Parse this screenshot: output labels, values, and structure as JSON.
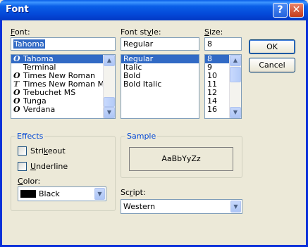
{
  "window": {
    "title": "Font",
    "help_glyph": "?",
    "close_glyph": "✕"
  },
  "font": {
    "label_key": "F",
    "label_rest": "ont:",
    "value": "Tahoma",
    "items": [
      {
        "label": "Tahoma",
        "icon": "O",
        "selected": true
      },
      {
        "label": "Terminal",
        "icon": "",
        "selected": false
      },
      {
        "label": "Times New Roman",
        "icon": "O",
        "selected": false
      },
      {
        "label": "Times New Roman MT",
        "icon": "T",
        "selected": false
      },
      {
        "label": "Trebuchet MS",
        "icon": "O",
        "selected": false
      },
      {
        "label": "Tunga",
        "icon": "O",
        "selected": false
      },
      {
        "label": "Verdana",
        "icon": "O",
        "selected": false
      }
    ]
  },
  "style": {
    "label_pre": "Font st",
    "label_key": "y",
    "label_post": "le:",
    "value": "Regular",
    "items": [
      {
        "label": "Regular",
        "selected": true
      },
      {
        "label": "Italic",
        "selected": false
      },
      {
        "label": "Bold",
        "selected": false
      },
      {
        "label": "Bold Italic",
        "selected": false
      }
    ]
  },
  "size": {
    "label_key": "S",
    "label_rest": "ize:",
    "value": "8",
    "items": [
      {
        "label": "8",
        "selected": true
      },
      {
        "label": "9",
        "selected": false
      },
      {
        "label": "10",
        "selected": false
      },
      {
        "label": "11",
        "selected": false
      },
      {
        "label": "12",
        "selected": false
      },
      {
        "label": "14",
        "selected": false
      },
      {
        "label": "16",
        "selected": false
      }
    ]
  },
  "buttons": {
    "ok": "OK",
    "cancel": "Cancel"
  },
  "effects": {
    "title": "Effects",
    "strikeout_key": "k",
    "strikeout_pre": "Stri",
    "strikeout_post": "eout",
    "underline_key": "U",
    "underline_rest": "nderline",
    "color_key": "C",
    "color_rest": "olor:",
    "color_value": "Black"
  },
  "sample": {
    "title": "Sample",
    "text": "AaBbYyZz"
  },
  "script": {
    "label_pre": "Sc",
    "label_key": "r",
    "label_post": "ipt:",
    "value": "Western"
  },
  "colors": {
    "selection": "#316ac5",
    "titlebar": "#0a5fe8",
    "group_title": "#0046d5"
  },
  "icons": {
    "truetype": "truetype-font-icon",
    "opentype": "opentype-font-icon"
  }
}
